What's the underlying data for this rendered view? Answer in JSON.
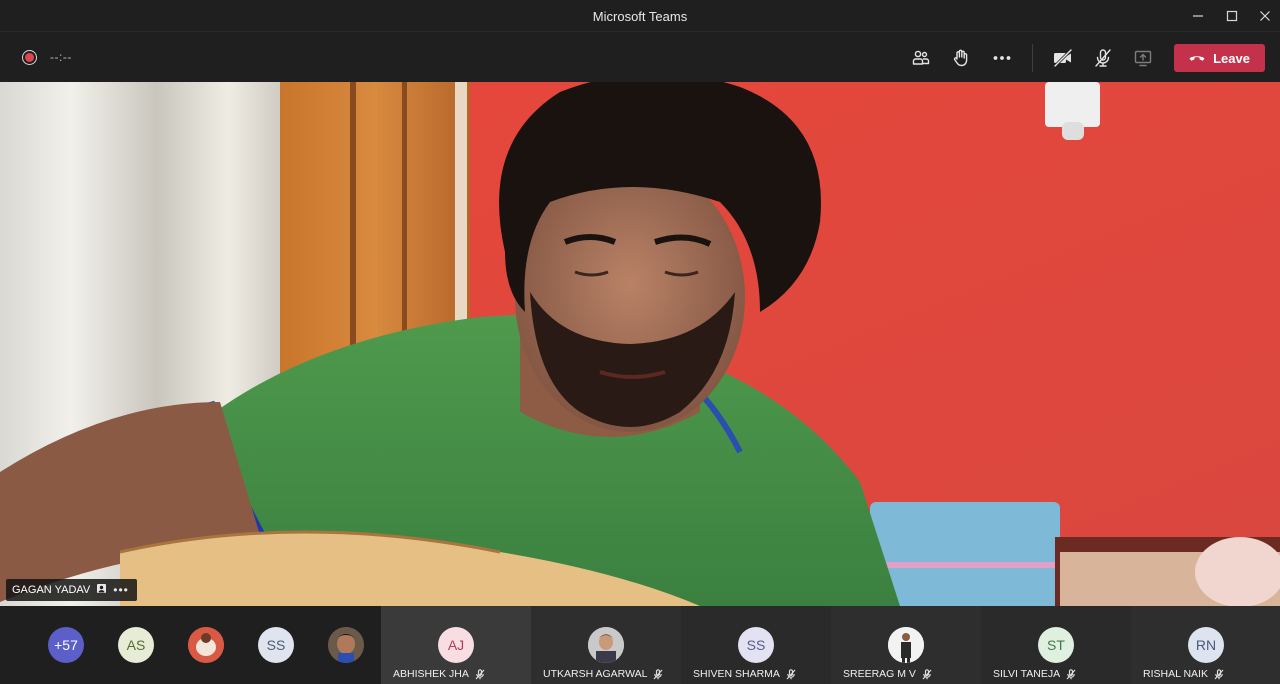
{
  "window": {
    "title": "Microsoft Teams"
  },
  "controls": {
    "timer": "--:--",
    "leave_label": "Leave",
    "icons": [
      "people-icon",
      "raise-hand-icon",
      "more-actions-icon",
      "camera-off-icon",
      "mic-muted-icon",
      "share-screen-icon",
      "end-call-icon"
    ]
  },
  "spotlight": {
    "name": "GAGAN YADAV",
    "more": "•••"
  },
  "overflow": {
    "count": "+57",
    "avatars": [
      {
        "initials": "AS",
        "bg": "#e7ecd7",
        "fg": "#5b6b2f"
      },
      {
        "initials": "",
        "bg": "#c44a3a",
        "fg": "#fff"
      },
      {
        "initials": "SS",
        "bg": "#dfe4ee",
        "fg": "#4e5a78"
      },
      {
        "initials": "",
        "bg": "#5a4a3a",
        "fg": "#fff"
      }
    ]
  },
  "participants": [
    {
      "initials": "AJ",
      "name": "ABHISHEK JHA",
      "bg": "#f8dde3",
      "fg": "#b73a58",
      "tile_bg": "#3a3a3a",
      "photo": false
    },
    {
      "initials": "",
      "name": "UTKARSH AGARWAL",
      "bg": "#c9c9c9",
      "fg": "#333",
      "tile_bg": "#2e2e2e",
      "photo": true
    },
    {
      "initials": "SS",
      "name": "SHIVEN SHARMA",
      "bg": "#e3e2f3",
      "fg": "#5b5b8e",
      "tile_bg": "#2a2a2a",
      "photo": false
    },
    {
      "initials": "",
      "name": "SREERAG M V",
      "bg": "#f0f0f0",
      "fg": "#333",
      "tile_bg": "#2e2e2e",
      "photo": true
    },
    {
      "initials": "ST",
      "name": "SILVI TANEJA",
      "bg": "#dff0e1",
      "fg": "#3f7a4b",
      "tile_bg": "#2a2a2a",
      "photo": false
    },
    {
      "initials": "RN",
      "name": "RISHAL NAIK",
      "bg": "#dde3ef",
      "fg": "#4a5a7c",
      "tile_bg": "#2e2e2e",
      "photo": false
    }
  ],
  "colors": {
    "leave": "#c4314b",
    "overflow_badge": "#5b5fc7",
    "record": "#e0474c"
  }
}
